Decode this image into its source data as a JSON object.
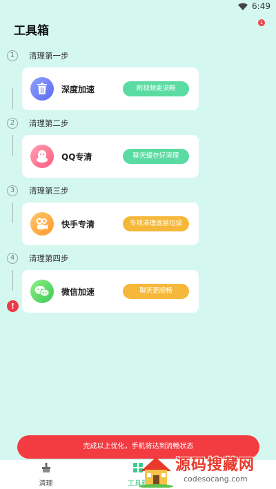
{
  "status_bar": {
    "time": "6:49"
  },
  "page": {
    "title": "工具箱",
    "notif_count": "1"
  },
  "steps": [
    {
      "num": "1",
      "label": "清理第一步",
      "card_title": "深度加速",
      "button": "刷视频更流畅",
      "icon": "trash-icon"
    },
    {
      "num": "2",
      "label": "清理第二步",
      "card_title": "QQ专清",
      "button": "聊天缓存好清理",
      "icon": "qq-icon"
    },
    {
      "num": "3",
      "label": "清理第三步",
      "card_title": "快手专清",
      "button": "专项清理底层垃圾",
      "icon": "kuaishou-icon"
    },
    {
      "num": "4",
      "label": "清理第四步",
      "card_title": "微信加速",
      "button": "聊天更顺畅",
      "icon": "wechat-icon"
    }
  ],
  "colors": {
    "background": "#d4f8ef",
    "green_button": "#59dba1",
    "orange_button": "#f6b83a",
    "banner": "#f23c42",
    "active_tab": "#3cc98d"
  },
  "banner": {
    "text": "完成以上优化，手机将达到流畅状态"
  },
  "tabs": [
    {
      "label": "清理",
      "icon": "broom-icon"
    },
    {
      "label": "工具箱",
      "icon": "grid-icon",
      "active": true
    }
  ],
  "watermark": {
    "title": "源码搜藏网",
    "subtitle": "codesocang.com"
  }
}
